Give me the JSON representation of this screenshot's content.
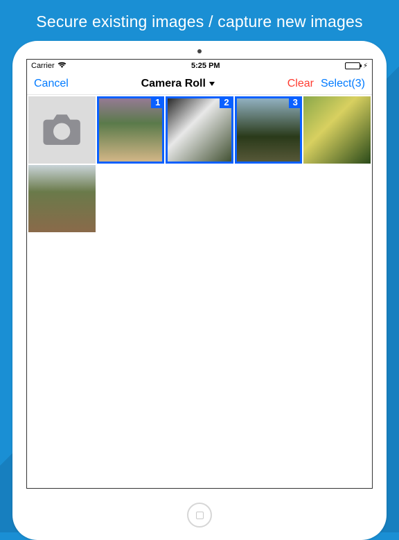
{
  "promo": "Secure existing images / capture new images",
  "status": {
    "carrier": "Carrier",
    "time": "5:25 PM"
  },
  "nav": {
    "cancel": "Cancel",
    "title": "Camera Roll",
    "clear": "Clear",
    "select_label": "Select",
    "select_count": "(3)"
  },
  "grid": {
    "selected_badges": [
      "1",
      "2",
      "3"
    ]
  }
}
